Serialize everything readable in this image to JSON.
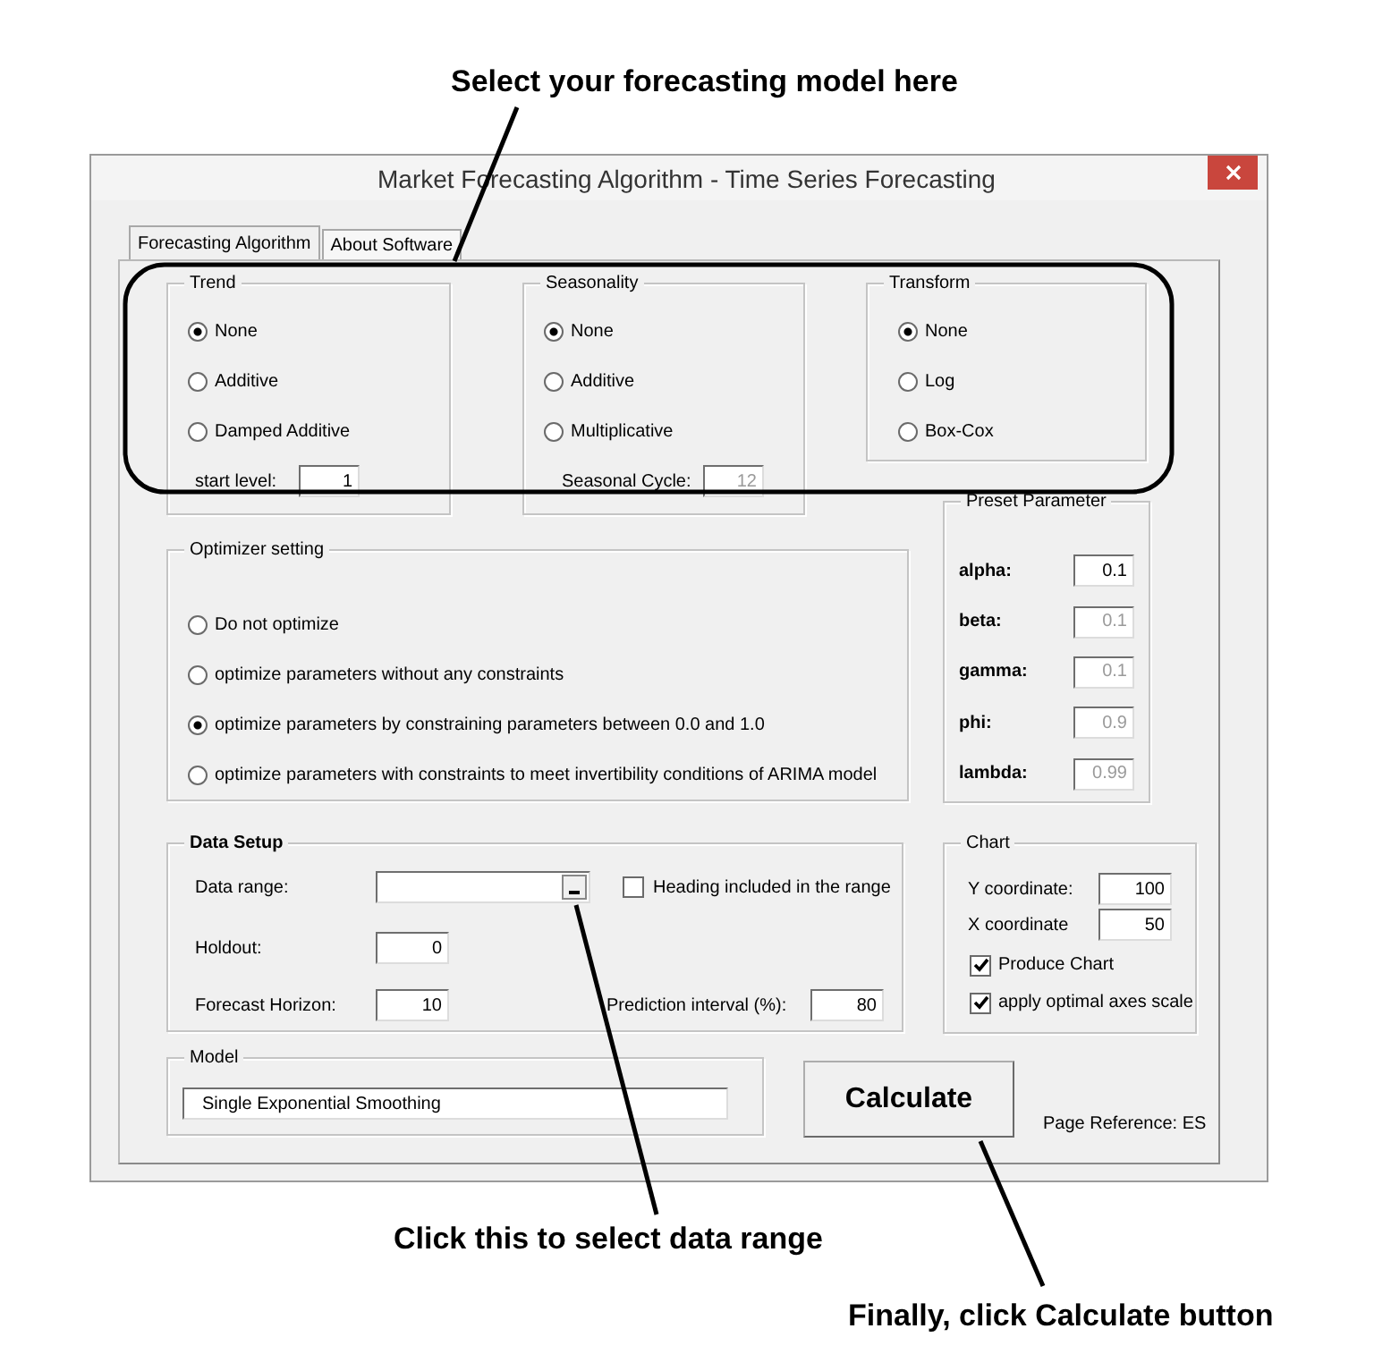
{
  "annotations": [
    {
      "text": "Select your forecasting model here"
    },
    {
      "text": "Click this to select data range"
    },
    {
      "text": "Finally, click Calculate button"
    }
  ],
  "window": {
    "title": "Market Forecasting Algorithm - Time Series Forecasting"
  },
  "tabs": [
    {
      "label": "Forecasting Algorithm",
      "selected": true
    },
    {
      "label": "About Software",
      "selected": false
    }
  ],
  "trend": {
    "title": "Trend",
    "options": [
      {
        "label": "None",
        "selected": true
      },
      {
        "label": "Additive",
        "selected": false
      },
      {
        "label": "Damped Additive",
        "selected": false
      }
    ],
    "field": {
      "label": "start level:",
      "value": "1",
      "disabled": false
    }
  },
  "seasonality": {
    "title": "Seasonality",
    "options": [
      {
        "label": "None",
        "selected": true
      },
      {
        "label": "Additive",
        "selected": false
      },
      {
        "label": "Multiplicative",
        "selected": false
      }
    ],
    "field": {
      "label": "Seasonal Cycle:",
      "value": "12",
      "disabled": true
    }
  },
  "transform": {
    "title": "Transform",
    "options": [
      {
        "label": "None",
        "selected": true
      },
      {
        "label": "Log",
        "selected": false
      },
      {
        "label": "Box-Cox",
        "selected": false
      }
    ]
  },
  "optimizer": {
    "title": "Optimizer setting",
    "options": [
      {
        "label": "Do not optimize",
        "selected": false
      },
      {
        "label": "optimize parameters without any constraints",
        "selected": false
      },
      {
        "label": "optimize parameters by constraining parameters between 0.0 and 1.0",
        "selected": true
      },
      {
        "label": "optimize parameters with constraints to meet invertibility conditions of ARIMA model",
        "selected": false
      }
    ]
  },
  "preset": {
    "title": "Preset Parameter",
    "params": [
      {
        "label": "alpha:",
        "value": "0.1",
        "disabled": false
      },
      {
        "label": "beta:",
        "value": "0.1",
        "disabled": true
      },
      {
        "label": "gamma:",
        "value": "0.1",
        "disabled": true
      },
      {
        "label": "phi:",
        "value": "0.9",
        "disabled": true
      },
      {
        "label": "lambda:",
        "value": "0.99",
        "disabled": true
      }
    ]
  },
  "data_setup": {
    "title": "Data Setup",
    "data_range": {
      "label": "Data range:"
    },
    "heading": {
      "label": "Heading included in the range",
      "checked": false
    },
    "holdout": {
      "label": "Holdout:",
      "value": "0"
    },
    "horizon": {
      "label": "Forecast Horizon:",
      "value": "10"
    },
    "interval": {
      "label": "Prediction interval (%):",
      "value": "80"
    }
  },
  "chart": {
    "title": "Chart",
    "y": {
      "label": "Y coordinate:",
      "value": "100"
    },
    "x": {
      "label": "X coordinate",
      "value": "50"
    },
    "options": [
      {
        "label": "Produce Chart",
        "checked": true
      },
      {
        "label": "apply optimal axes scale",
        "checked": true
      }
    ]
  },
  "model": {
    "title": "Model",
    "value": "Single Exponential Smoothing"
  },
  "calculate_button": "Calculate",
  "page_reference": "Page Reference: ES"
}
